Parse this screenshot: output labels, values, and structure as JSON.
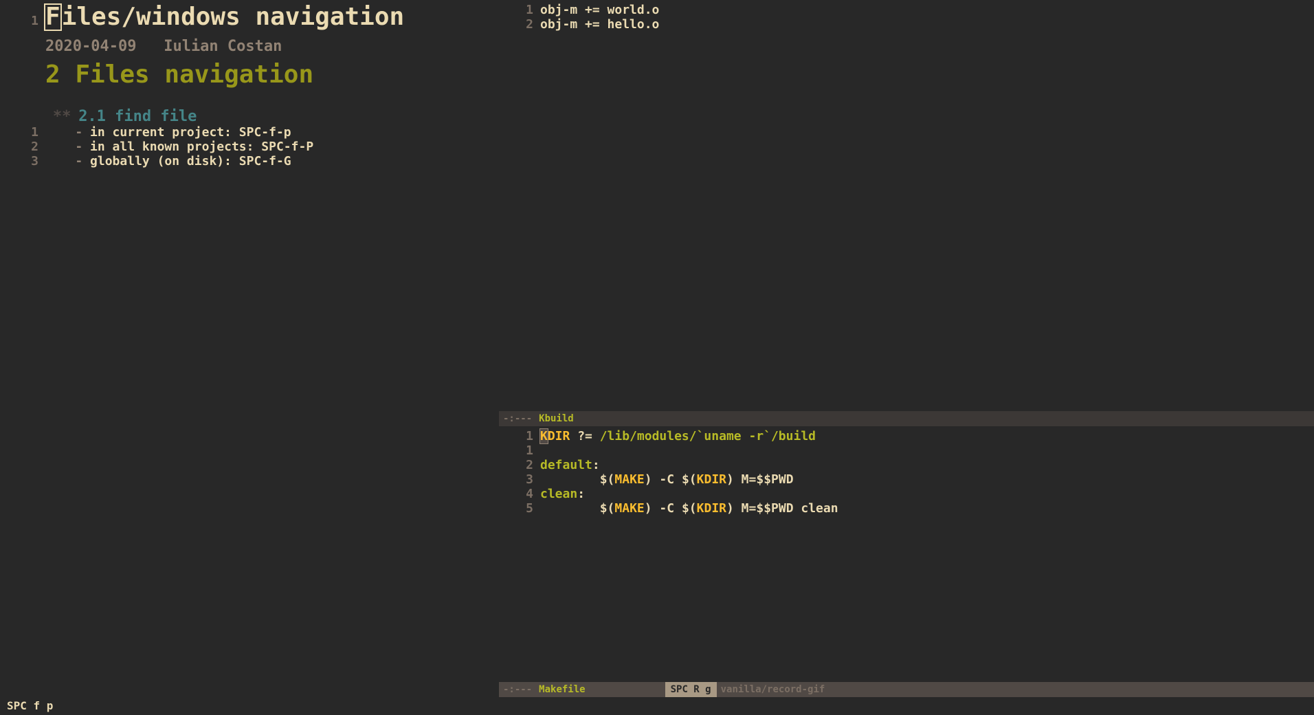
{
  "org": {
    "title_gutter": "1",
    "title_first_char": "F",
    "title_rest": "iles/windows navigation",
    "date": "2020-04-09",
    "author": "Iulian Costan",
    "h1": "2 Files navigation",
    "h2_stars": "**",
    "h2": "2.1 find file",
    "items": [
      {
        "n": "1",
        "text": "in current project: SPC-f-p"
      },
      {
        "n": "2",
        "text": "in all known projects: SPC-f-P"
      },
      {
        "n": "3",
        "text": "globally (on disk): SPC-f-G"
      }
    ]
  },
  "kbuild": {
    "lines": [
      {
        "n": "1",
        "text": "obj-m += world.o"
      },
      {
        "n": "2",
        "text": "obj-m += hello.o"
      }
    ],
    "modeline_state": "-:---",
    "modeline_name": "Kbuild"
  },
  "makefile": {
    "l1_n": "1",
    "l1_cursor": "K",
    "l1_var": "DIR",
    "l1_op": " ?= ",
    "l1_str": "/lib/modules/`uname -r`/build",
    "l2_n": "1",
    "l3_n": "2",
    "l3_target": "default",
    "l3_colon": ":",
    "l4_n": "3",
    "l4_indent": "        ",
    "l4_d1": "$(",
    "l4_make": "MAKE",
    "l4_d2": ")",
    "l4_mid": " -C ",
    "l4_d3": "$(",
    "l4_kdir": "KDIR",
    "l4_d4": ")",
    "l4_tail": " M=$$PWD",
    "l5_n": "4",
    "l5_target": "clean",
    "l5_colon": ":",
    "l6_n": "5",
    "l6_indent": "        ",
    "l6_d1": "$(",
    "l6_make": "MAKE",
    "l6_d2": ")",
    "l6_mid": " -C ",
    "l6_d3": "$(",
    "l6_kdir": "KDIR",
    "l6_d4": ")",
    "l6_tail": " M=$$PWD clean",
    "modeline_state": "-:---",
    "modeline_name": "Makefile",
    "modeline_pill": "SPC R g",
    "modeline_project": "vanilla/record-gif"
  },
  "echo": "SPC f p"
}
